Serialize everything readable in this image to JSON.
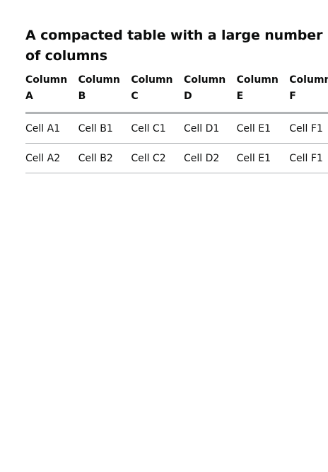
{
  "table": {
    "caption": "A compacted table with a large number of columns",
    "headers": [
      {
        "word": "Column",
        "letter": "A"
      },
      {
        "word": "Column",
        "letter": "B"
      },
      {
        "word": "Column",
        "letter": "C"
      },
      {
        "word": "Column",
        "letter": "D"
      },
      {
        "word": "Column",
        "letter": "E"
      },
      {
        "word": "Column",
        "letter": "F"
      }
    ],
    "rows": [
      [
        "Cell A1",
        "Cell B1",
        "Cell C1",
        "Cell D1",
        "Cell E1",
        "Cell F1"
      ],
      [
        "Cell A2",
        "Cell B2",
        "Cell C2",
        "Cell D2",
        "Cell E1",
        "Cell F1"
      ]
    ]
  },
  "colors": {
    "text": "#0b0c0c",
    "border": "#b1b4b6",
    "background": "#ffffff"
  }
}
